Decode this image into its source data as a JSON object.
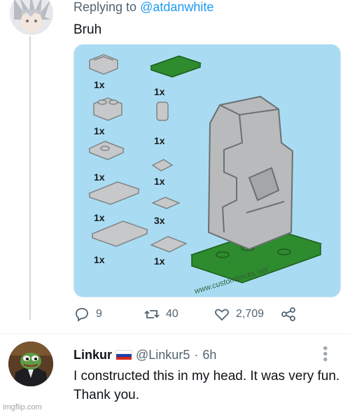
{
  "first_tweet": {
    "reply_prefix": "Replying to",
    "reply_handle": "@atdanwhite",
    "text": "Bruh",
    "media": {
      "watermark": "www.custombricks.net",
      "left_column_counts": [
        "1x",
        "1x",
        "1x",
        "1x",
        "1x"
      ],
      "right_column_counts": [
        "1x",
        "1x",
        "1x",
        "3x",
        "1x"
      ]
    },
    "actions": {
      "replies": "9",
      "retweets": "40",
      "likes": "2,709"
    }
  },
  "reply_tweet": {
    "name": "Linkur",
    "handle": "@Linkur5",
    "separator": "·",
    "time": "6h",
    "text": "I constructed this in my head. It was very fun. Thank you."
  },
  "site_watermark": "imgflip.com",
  "colors": {
    "handle_blue": "#1d9bf0",
    "muted_text": "#536471",
    "media_bg": "#a9dcf3",
    "brick_gray": "#c9cbcc",
    "baseplate_green": "#2e8b2e"
  },
  "icons": [
    "reply-icon",
    "retweet-icon",
    "like-icon",
    "share-icon",
    "russia-flag-icon",
    "more-options-icon"
  ]
}
